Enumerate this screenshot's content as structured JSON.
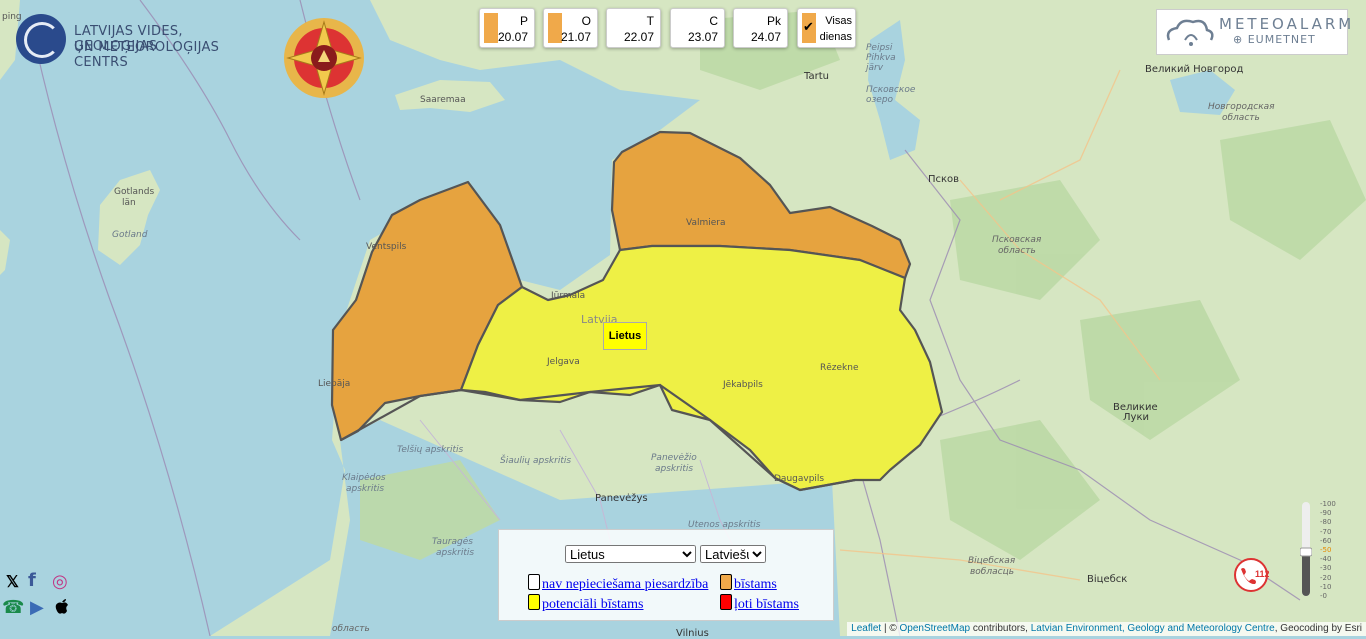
{
  "header": {
    "org_line1": "LATVIJAS VIDES, ĢEOLOĢIJAS",
    "org_line2": "UN METEOROLOĢIJAS CENTRS",
    "meteoalarm_line1": "METEOALARM",
    "meteoalarm_line2": "EUMETNET"
  },
  "days": [
    {
      "name": "P",
      "date": "20.07",
      "color": "#f0a94a"
    },
    {
      "name": "O",
      "date": "21.07",
      "color": "#f0a94a"
    },
    {
      "name": "T",
      "date": "22.07",
      "color": ""
    },
    {
      "name": "C",
      "date": "23.07",
      "color": ""
    },
    {
      "name": "Pk",
      "date": "24.07",
      "color": ""
    },
    {
      "name": "Visas",
      "date": "dienas",
      "color": "#f0a94a"
    }
  ],
  "map": {
    "warning_label": "Lietus",
    "region_colors": {
      "orange": "#e6a33f",
      "yellow": "#eef045"
    },
    "labels": {
      "ping": "ping",
      "saaremaa": "Saaremaa",
      "gotlands": "Gotlands",
      "lan": "län",
      "gotland": "Gotland",
      "tartu": "Tartu",
      "peipsi": "Peipsi",
      "pihkva": "Pihkva",
      "jarv": "järv",
      "pskovskoe": "Псковское",
      "ozero": "озеро",
      "novgorod": "Великий Новгород",
      "novgorod_obl1": "Новгородская",
      "novgorod_obl2": "область",
      "pskov": "Псков",
      "pskov_obl1": "Псковская",
      "pskov_obl2": "область",
      "velikie": "Великие",
      "luki": "Луки",
      "vitebsk_obl1": "Віцебская",
      "vitebsk_obl2": "вобласць",
      "vitebsk": "Віцебск",
      "valmiera": "Valmiera",
      "ventspils": "Ventspils",
      "jurmala": "Jūrmala",
      "latvija": "Latvija",
      "jelgava": "Jelgava",
      "liepaja": "Liepāja",
      "jekabpils": "Jēkabpils",
      "rezekne": "Rēzekne",
      "daugavpils": "Daugavpils",
      "telsiu": "Telšių apskritis",
      "siauliu": "Šiaulių apskritis",
      "panevezio1": "Panevėžio",
      "panevezio2": "apskritis",
      "panevezys": "Panevėžys",
      "klaipedos1": "Klaipėdos",
      "klaipedos2": "apskritis",
      "utenos": "Utenos apskritis",
      "taurages1": "Tauragės",
      "taurages2": "apskritis",
      "oblast": "область",
      "vilnius": "Vilnius"
    }
  },
  "legend": {
    "warning_type": "Lietus",
    "language": "Latviešu",
    "items": [
      {
        "label": "nav nepieciešama piesardzība",
        "color": "#ffffff"
      },
      {
        "label": "bīstams",
        "color": "#f0a94a"
      },
      {
        "label": "potenciāli bīstams",
        "color": "#ffff00"
      },
      {
        "label": "ļoti bīstams",
        "color": "#ff0000"
      }
    ]
  },
  "slider_ticks": [
    "-100",
    "-90",
    "-80",
    "-70",
    "-60",
    "-50",
    "-40",
    "-30",
    "-20",
    "-10",
    "-0"
  ],
  "call_number": "112",
  "attribution": {
    "leaflet": "Leaflet",
    "sep": " | © ",
    "osm": "OpenStreetMap",
    "contributors": " contributors, ",
    "lvgmc": "Latvian Environment, Geology and Meteorology Centre",
    "geocoding": ", Geocoding by Esri"
  },
  "social": {
    "x": "𝕏",
    "facebook": "f",
    "instagram": "◎",
    "phone": "☎",
    "play": "▶",
    "apple": ""
  }
}
